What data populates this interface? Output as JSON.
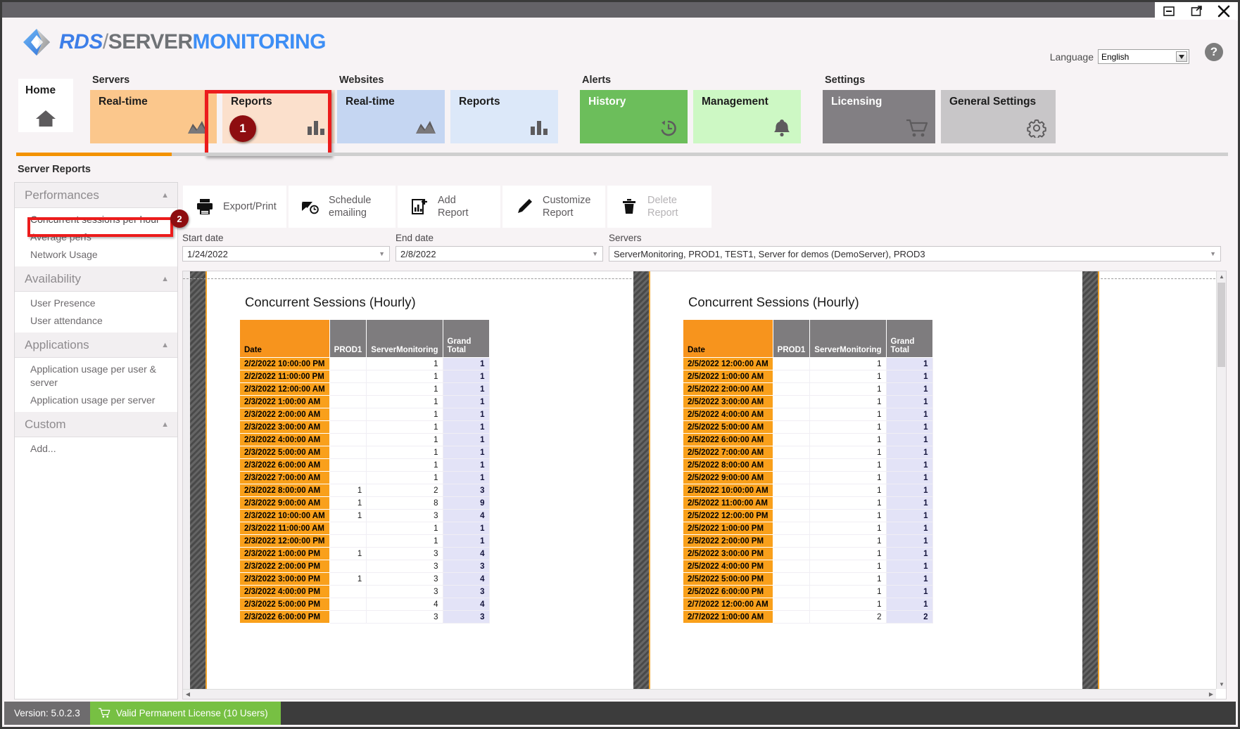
{
  "window": {
    "controls": [
      "minimize-icon",
      "restore-icon",
      "close-icon"
    ]
  },
  "header": {
    "logo": {
      "rds": "RDS",
      "separator": "/",
      "server": "SERVER",
      "monitoring": "MONITORING"
    },
    "language_label": "Language",
    "language_value": "English",
    "help_glyph": "?"
  },
  "nav": {
    "groups": [
      {
        "label": "",
        "tiles": [
          {
            "label": "Home",
            "icon": "home-icon",
            "style": "home"
          }
        ]
      },
      {
        "label": "Servers",
        "tiles": [
          {
            "label": "Real-time",
            "icon": "area-chart-icon",
            "style": "orange"
          },
          {
            "label": "Reports",
            "icon": "bar-chart-icon",
            "style": "orange-light",
            "highlighted": true,
            "step": "1"
          }
        ]
      },
      {
        "label": "Websites",
        "tiles": [
          {
            "label": "Real-time",
            "icon": "area-chart-icon",
            "style": "blue"
          },
          {
            "label": "Reports",
            "icon": "bar-chart-icon",
            "style": "blue-light"
          }
        ]
      },
      {
        "label": "Alerts",
        "tiles": [
          {
            "label": "History",
            "icon": "history-clock-icon",
            "style": "green"
          },
          {
            "label": "Management",
            "icon": "bell-icon",
            "style": "green-light"
          }
        ]
      },
      {
        "label": "Settings",
        "tiles": [
          {
            "label": "Licensing",
            "icon": "cart-icon",
            "style": "gray"
          },
          {
            "label": "General Settings",
            "icon": "gear-icon",
            "style": "gray-light"
          }
        ]
      }
    ]
  },
  "section_title": "Server Reports",
  "sidebar": {
    "sections": [
      {
        "title": "Performances",
        "items": [
          "Concurrent sessions per hour",
          "Average perfs",
          "Network Usage"
        ],
        "selected_index": 0,
        "step": "2"
      },
      {
        "title": "Availability",
        "items": [
          "User Presence",
          "User attendance"
        ]
      },
      {
        "title": "Applications",
        "items": [
          "Application usage per user & server",
          "Application usage per server"
        ]
      },
      {
        "title": "Custom",
        "items": [
          "Add..."
        ]
      }
    ]
  },
  "toolbar": {
    "buttons": [
      {
        "label": "Export/Print",
        "icon": "printer-icon",
        "disabled": false
      },
      {
        "label": "Schedule emailing",
        "icon": "schedule-email-icon",
        "disabled": false
      },
      {
        "label": "Add Report",
        "icon": "add-report-icon",
        "disabled": false
      },
      {
        "label": "Customize Report",
        "icon": "pencil-icon",
        "disabled": false
      },
      {
        "label": "Delete Report",
        "icon": "trash-icon",
        "disabled": true
      }
    ]
  },
  "filters": {
    "start_date_label": "Start date",
    "start_date_value": "1/24/2022",
    "end_date_label": "End date",
    "end_date_value": "2/8/2022",
    "servers_label": "Servers",
    "servers_value": "ServerMonitoring, PROD1, TEST1, Server for demos (DemoServer), PROD3"
  },
  "report": {
    "title": "Concurrent Sessions (Hourly)",
    "columns": [
      "Date",
      "PROD1",
      "ServerMonitoring",
      "Grand Total"
    ],
    "page_left": {
      "rows": [
        [
          "2/2/2022 10:00:00 PM",
          "",
          "1",
          "1"
        ],
        [
          "2/2/2022 11:00:00 PM",
          "",
          "1",
          "1"
        ],
        [
          "2/3/2022 12:00:00 AM",
          "",
          "1",
          "1"
        ],
        [
          "2/3/2022 1:00:00 AM",
          "",
          "1",
          "1"
        ],
        [
          "2/3/2022 2:00:00 AM",
          "",
          "1",
          "1"
        ],
        [
          "2/3/2022 3:00:00 AM",
          "",
          "1",
          "1"
        ],
        [
          "2/3/2022 4:00:00 AM",
          "",
          "1",
          "1"
        ],
        [
          "2/3/2022 5:00:00 AM",
          "",
          "1",
          "1"
        ],
        [
          "2/3/2022 6:00:00 AM",
          "",
          "1",
          "1"
        ],
        [
          "2/3/2022 7:00:00 AM",
          "",
          "1",
          "1"
        ],
        [
          "2/3/2022 8:00:00 AM",
          "1",
          "2",
          "3"
        ],
        [
          "2/3/2022 9:00:00 AM",
          "1",
          "8",
          "9"
        ],
        [
          "2/3/2022 10:00:00 AM",
          "1",
          "3",
          "4"
        ],
        [
          "2/3/2022 11:00:00 AM",
          "",
          "1",
          "1"
        ],
        [
          "2/3/2022 12:00:00 PM",
          "",
          "1",
          "1"
        ],
        [
          "2/3/2022 1:00:00 PM",
          "1",
          "3",
          "4"
        ],
        [
          "2/3/2022 2:00:00 PM",
          "",
          "3",
          "3"
        ],
        [
          "2/3/2022 3:00:00 PM",
          "1",
          "3",
          "4"
        ],
        [
          "2/3/2022 4:00:00 PM",
          "",
          "3",
          "3"
        ],
        [
          "2/3/2022 5:00:00 PM",
          "",
          "4",
          "4"
        ],
        [
          "2/3/2022 6:00:00 PM",
          "",
          "3",
          "3"
        ]
      ]
    },
    "page_right": {
      "rows": [
        [
          "2/5/2022 12:00:00 AM",
          "",
          "1",
          "1"
        ],
        [
          "2/5/2022 1:00:00 AM",
          "",
          "1",
          "1"
        ],
        [
          "2/5/2022 2:00:00 AM",
          "",
          "1",
          "1"
        ],
        [
          "2/5/2022 3:00:00 AM",
          "",
          "1",
          "1"
        ],
        [
          "2/5/2022 4:00:00 AM",
          "",
          "1",
          "1"
        ],
        [
          "2/5/2022 5:00:00 AM",
          "",
          "1",
          "1"
        ],
        [
          "2/5/2022 6:00:00 AM",
          "",
          "1",
          "1"
        ],
        [
          "2/5/2022 7:00:00 AM",
          "",
          "1",
          "1"
        ],
        [
          "2/5/2022 8:00:00 AM",
          "",
          "1",
          "1"
        ],
        [
          "2/5/2022 9:00:00 AM",
          "",
          "1",
          "1"
        ],
        [
          "2/5/2022 10:00:00 AM",
          "",
          "1",
          "1"
        ],
        [
          "2/5/2022 11:00:00 AM",
          "",
          "1",
          "1"
        ],
        [
          "2/5/2022 12:00:00 PM",
          "",
          "1",
          "1"
        ],
        [
          "2/5/2022 1:00:00 PM",
          "",
          "1",
          "1"
        ],
        [
          "2/5/2022 2:00:00 PM",
          "",
          "1",
          "1"
        ],
        [
          "2/5/2022 3:00:00 PM",
          "",
          "1",
          "1"
        ],
        [
          "2/5/2022 4:00:00 PM",
          "",
          "1",
          "1"
        ],
        [
          "2/5/2022 5:00:00 PM",
          "",
          "1",
          "1"
        ],
        [
          "2/5/2022 6:00:00 PM",
          "",
          "1",
          "1"
        ],
        [
          "2/7/2022 12:00:00 AM",
          "",
          "1",
          "1"
        ],
        [
          "2/7/2022 1:00:00 AM",
          "",
          "2",
          "2"
        ]
      ]
    }
  },
  "status": {
    "version": "Version: 5.0.2.3",
    "license": "Valid Permanent License (10 Users)",
    "license_icon": "cart-icon"
  },
  "colors": {
    "accent_orange": "#f39200",
    "date_cell": "#f9a01b",
    "header_gray": "#7e7c7e",
    "total_bg": "#e3e3f7",
    "license_green": "#77c043",
    "highlight_red": "#ec1c1c",
    "badge_dark_red": "#8e0d10"
  }
}
